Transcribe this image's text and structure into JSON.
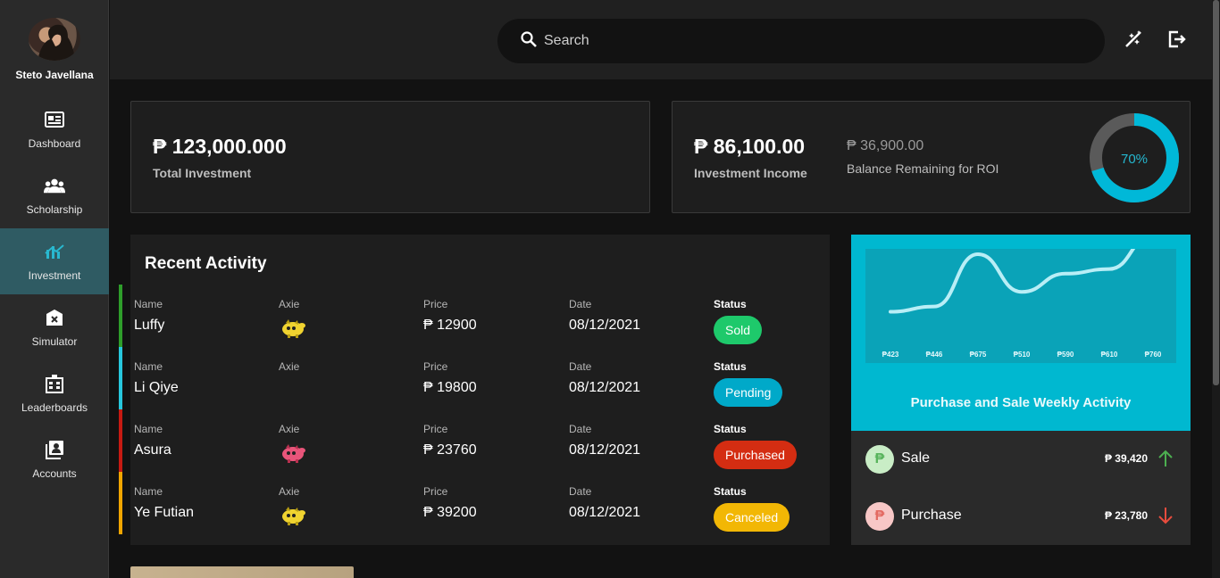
{
  "user": {
    "name": "Steto Javellana"
  },
  "nav": [
    {
      "label": "Dashboard",
      "icon": "newspaper-icon"
    },
    {
      "label": "Scholarship",
      "icon": "people-icon"
    },
    {
      "label": "Investment",
      "icon": "chart-icon",
      "active": true
    },
    {
      "label": "Simulator",
      "icon": "calculator-icon"
    },
    {
      "label": "Leaderboards",
      "icon": "leaderboard-icon"
    },
    {
      "label": "Accounts",
      "icon": "contacts-icon"
    }
  ],
  "search": {
    "placeholder": "Search"
  },
  "stats": {
    "total_investment": "₱ 123,000.000",
    "total_investment_label": "Total Investment",
    "investment_income": "₱ 86,100.00",
    "investment_income_label": "Investment Income",
    "balance_remaining": "₱ 36,900.00",
    "balance_remaining_label": "Balance Remaining for ROI",
    "roi_percent_text": "70%",
    "roi_fraction": 0.7
  },
  "activity": {
    "title": "Recent Activity",
    "headers": {
      "name": "Name",
      "axie": "Axie",
      "price": "Price",
      "date": "Date",
      "status": "Status"
    },
    "rows": [
      {
        "name": "Luffy",
        "axie": "yellow",
        "price": "₱ 12900",
        "date": "08/12/2021",
        "status": "Sold",
        "status_color": "#1ec96b",
        "bar_color": "#2e9d2a"
      },
      {
        "name": "Li Qiye",
        "axie": "",
        "price": "₱ 19800",
        "date": "08/12/2021",
        "status": "Pending",
        "status_color": "#00a9c9",
        "bar_color": "#27c6dc"
      },
      {
        "name": "Asura",
        "axie": "pink",
        "price": "₱ 23760",
        "date": "08/12/2021",
        "status": "Purchased",
        "status_color": "#d42d12",
        "bar_color": "#c61a12"
      },
      {
        "name": "Ye Futian",
        "axie": "yellow",
        "price": "₱ 39200",
        "date": "08/12/2021",
        "status": "Canceled",
        "status_color": "#f2b705",
        "bar_color": "#f0a500"
      }
    ]
  },
  "weekly": {
    "title": "Purchase and Sale Weekly Activity",
    "sale_label": "Sale",
    "sale_amount": "₱ 39,420",
    "purchase_label": "Purchase",
    "purchase_amount": "₱ 23,780",
    "sale_color": "#4caf50",
    "purchase_color": "#e84c3d"
  },
  "chart_data": {
    "type": "line",
    "categories": [
      "₱423",
      "₱446",
      "₱675",
      "₱510",
      "₱590",
      "₱610",
      "₱760"
    ],
    "values": [
      423,
      446,
      675,
      510,
      590,
      610,
      760
    ],
    "title": "",
    "xlabel": "",
    "ylabel": "",
    "grid": false
  }
}
